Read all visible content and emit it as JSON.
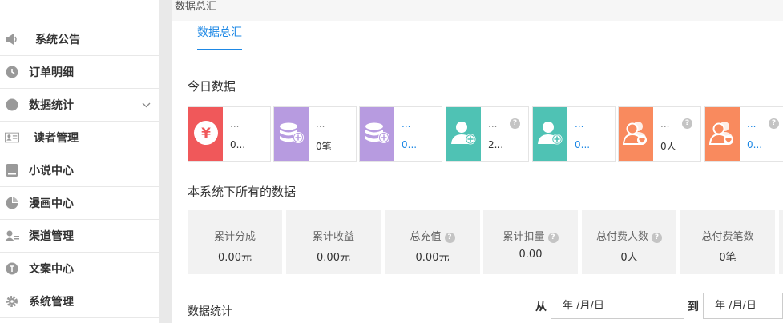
{
  "breadcrumb": "数据总汇",
  "tab": "数据总汇",
  "sidebar": {
    "items": [
      {
        "label": "系统公告",
        "icon": "speaker-icon"
      },
      {
        "label": "订单明细",
        "icon": "order-icon"
      },
      {
        "label": "数据统计",
        "icon": "pie-chart-icon",
        "has_chevron": true
      },
      {
        "label": "读者管理",
        "icon": "id-card-icon"
      },
      {
        "label": "小说中心",
        "icon": "book-icon"
      },
      {
        "label": "漫画中心",
        "icon": "comic-icon"
      },
      {
        "label": "渠道管理",
        "icon": "user-manage-icon"
      },
      {
        "label": "文案中心",
        "icon": "text-icon"
      },
      {
        "label": "系统管理",
        "icon": "gear-icon"
      }
    ]
  },
  "today": {
    "title": "今日数据",
    "cards": [
      {
        "title": "...",
        "value": "0...",
        "color": "#f0585a",
        "icon": "yen-icon",
        "value_blue": false,
        "help": false
      },
      {
        "title": "...",
        "value": "0笔",
        "color": "#b79be0",
        "icon": "coins-plus-icon",
        "value_blue": false,
        "help": false
      },
      {
        "title": "...",
        "value": "0...",
        "color": "#b79be0",
        "icon": "coins-plus-icon",
        "value_blue": true,
        "help": false
      },
      {
        "title": "...",
        "value": "2...",
        "color": "#4fc2b4",
        "icon": "user-add-icon",
        "value_blue": false,
        "help": true
      },
      {
        "title": "...",
        "value": "0...",
        "color": "#4fc2b4",
        "icon": "user-add-icon",
        "value_blue": true,
        "help": false
      },
      {
        "title": "...",
        "value": "0人",
        "color": "#f98a5e",
        "icon": "users-heart-icon",
        "value_blue": false,
        "help": true
      },
      {
        "title": "...",
        "value": "0...",
        "color": "#f98a5e",
        "icon": "users-heart-icon",
        "value_blue": true,
        "help": true
      }
    ]
  },
  "summary": {
    "title": "本系统下所有的数据",
    "items": [
      {
        "label": "累计分成",
        "value": "0.00元",
        "help": false
      },
      {
        "label": "累计收益",
        "value": "0.00元",
        "help": false
      },
      {
        "label": "总充值",
        "value": "0.00元",
        "help": true
      },
      {
        "label": "累计扣量",
        "value": "0.00",
        "help": true
      },
      {
        "label": "总付费人数",
        "value": "0人",
        "help": true
      },
      {
        "label": "总付费笔数",
        "value": "0笔",
        "help": false
      }
    ]
  },
  "stats": {
    "title": "数据统计",
    "from_label": "从",
    "to_label": "到",
    "from_value": "年 /月/日",
    "to_value": "年 /月/日"
  },
  "help_glyph": "?"
}
